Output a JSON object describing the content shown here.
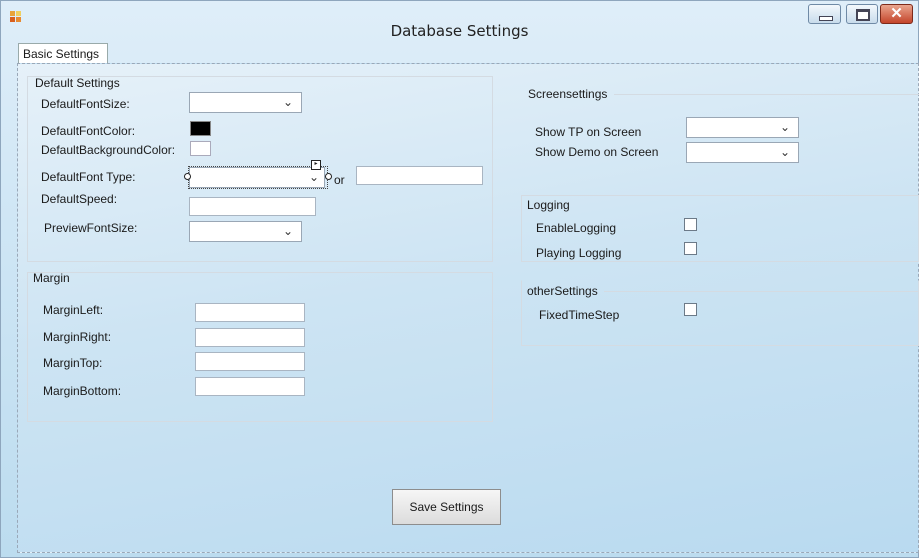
{
  "window": {
    "title": "Database Settings"
  },
  "tabs": [
    {
      "label": "Basic Settings"
    }
  ],
  "default_settings": {
    "title": "Default Settings",
    "font_size_label": "DefaultFontSize:",
    "font_size_value": "",
    "font_color_label": "DefaultFontColor:",
    "font_color": "#000000",
    "bg_color_label": "DefaultBackgroundColor:",
    "bg_color": "#ffffff",
    "font_type_label": "DefaultFont Type:",
    "font_type_value": "",
    "or_label": "or",
    "font_type_custom": "",
    "speed_label": "DefaultSpeed:",
    "speed_value": "",
    "preview_size_label": "PreviewFontSize:",
    "preview_size_value": ""
  },
  "margin": {
    "title": "Margin",
    "left_label": "MarginLeft:",
    "right_label": "MarginRight:",
    "top_label": "MarginTop:",
    "bottom_label": "MarginBottom:",
    "left_value": "",
    "right_value": "",
    "top_value": "",
    "bottom_value": ""
  },
  "screen_settings": {
    "title": "Screensettings",
    "show_tp_label": "Show TP on Screen",
    "show_tp_value": "",
    "show_demo_label": "Show Demo on Screen",
    "show_demo_value": ""
  },
  "logging": {
    "title": "Logging",
    "enable_label": "EnableLogging",
    "enable_checked": false,
    "playing_label": "Playing Logging",
    "playing_checked": false
  },
  "other_settings": {
    "title": "otherSettings",
    "fixed_label": "FixedTimeStep",
    "fixed_checked": false
  },
  "actions": {
    "save_label": "Save Settings"
  },
  "icons": {
    "app": "app-icon",
    "minimize": "minimize-icon",
    "maximize": "maximize-icon",
    "close": "close-icon",
    "dropdown": "chevron-down-icon"
  }
}
